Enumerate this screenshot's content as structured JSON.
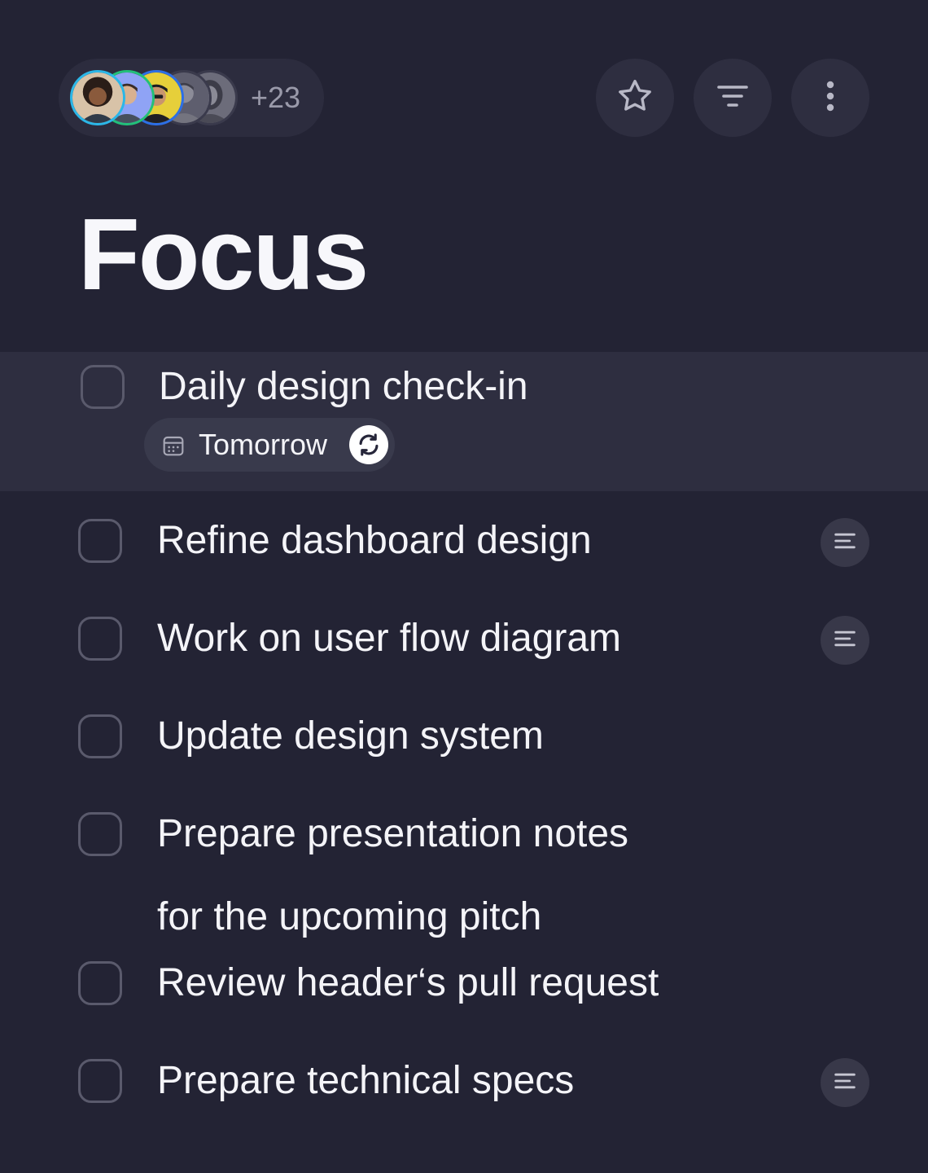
{
  "header": {
    "avatars": [
      {
        "name": "avatar-woman-curly",
        "ring": "#2bb7e8",
        "bg": "#d8c3a8"
      },
      {
        "name": "avatar-man-blue",
        "ring": "#22c07a",
        "bg": "#8fa3f5"
      },
      {
        "name": "avatar-man-cap",
        "ring": "#2c6fe6",
        "bg": "#e6cf3a"
      },
      {
        "name": "avatar-man-gray",
        "ring": "#3a3a4c",
        "bg": "#5e5e6e"
      },
      {
        "name": "avatar-woman-gray",
        "ring": "#3a3a4c",
        "bg": "#6c6c7a"
      }
    ],
    "member_count": "+23",
    "actions": [
      {
        "name": "favorite-button",
        "icon": "star-icon"
      },
      {
        "name": "filter-button",
        "icon": "filter-lines-icon"
      },
      {
        "name": "more-button",
        "icon": "more-vertical-icon"
      }
    ]
  },
  "title": "Focus",
  "tasks": [
    {
      "text": "Daily design check-in",
      "due": "Tomorrow",
      "repeat_icon": "repeat-icon",
      "calendar_icon": "calendar-icon",
      "highlighted": true,
      "has_notes": false
    },
    {
      "text": "Refine dashboard design",
      "has_notes": true
    },
    {
      "text": "Work on user flow diagram",
      "has_notes": true
    },
    {
      "text": "Update design system",
      "has_notes": false
    },
    {
      "text": "Prepare presentation notes",
      "text_line2": "for the upcoming pitch",
      "has_notes": false
    },
    {
      "text": "Review header‘s pull request",
      "has_notes": false
    },
    {
      "text": "Prepare technical specs",
      "has_notes": true
    }
  ],
  "colors": {
    "background": "#232334",
    "highlight_row": "#2e2e40",
    "checkbox_border": "#5a5a6c",
    "text": "#f4f4f8",
    "muted_text": "#9a9aaa"
  }
}
